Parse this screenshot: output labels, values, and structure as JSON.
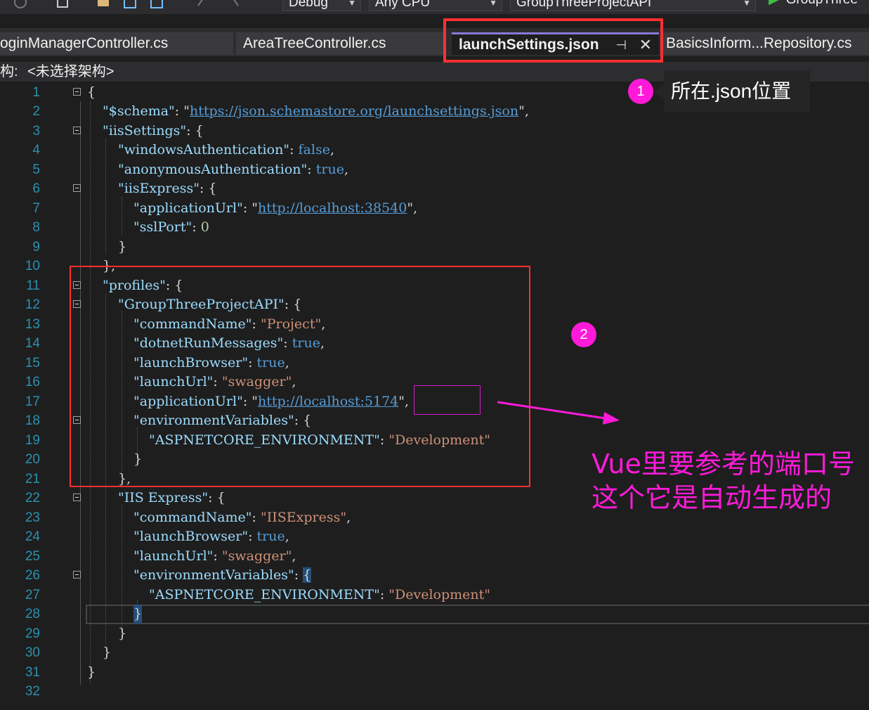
{
  "toolbar": {
    "config": "Debug",
    "platform": "Any CPU",
    "startup_project": "GroupThreeProjectAPI",
    "run_label": "GroupThree"
  },
  "tabs": [
    {
      "label": "oginManagerController.cs"
    },
    {
      "label": "AreaTreeController.cs"
    },
    {
      "label": "launchSettings.json",
      "active": true
    },
    {
      "label": "BasicsInform...Repository.cs"
    }
  ],
  "navbar": {
    "prefix": "构:",
    "value": "<未选择架构>"
  },
  "line_numbers": [
    "1",
    "2",
    "3",
    "4",
    "5",
    "6",
    "7",
    "8",
    "9",
    "10",
    "11",
    "12",
    "13",
    "14",
    "15",
    "16",
    "17",
    "18",
    "19",
    "20",
    "21",
    "22",
    "23",
    "24",
    "25",
    "26",
    "27",
    "28",
    "29",
    "30",
    "31",
    "32"
  ],
  "code": {
    "l1": "{",
    "l2_key": "\"$schema\"",
    "l2_val": "https://json.schemastore.org/launchsettings.json",
    "l3_key": "\"iisSettings\"",
    "l4_key": "\"windowsAuthentication\"",
    "l4_val": "false",
    "l5_key": "\"anonymousAuthentication\"",
    "l5_val": "true",
    "l6_key": "\"iisExpress\"",
    "l7_key": "\"applicationUrl\"",
    "l7_val": "http://localhost:38540",
    "l8_key": "\"sslPort\"",
    "l8_val": "0",
    "l9": "}",
    "l10": "},",
    "l11_key": "\"profiles\"",
    "l12_key": "\"GroupThreeProjectAPI\"",
    "l13_key": "\"commandName\"",
    "l13_val": "\"Project\"",
    "l14_key": "\"dotnetRunMessages\"",
    "l14_val": "true",
    "l15_key": "\"launchBrowser\"",
    "l15_val": "true",
    "l16_key": "\"launchUrl\"",
    "l16_val": "\"swagger\"",
    "l17_key": "\"applicationUrl\"",
    "l17_val_a": "http://localhost:",
    "l17_val_b": "5174",
    "l18_key": "\"environmentVariables\"",
    "l19_key": "\"ASPNETCORE_ENVIRONMENT\"",
    "l19_val": "\"Development\"",
    "l20": "}",
    "l21": "},",
    "l22_key": "\"IIS Express\"",
    "l23_key": "\"commandName\"",
    "l23_val": "\"IISExpress\"",
    "l24_key": "\"launchBrowser\"",
    "l24_val": "true",
    "l25_key": "\"launchUrl\"",
    "l25_val": "\"swagger\"",
    "l26_key": "\"environmentVariables\"",
    "l27_key": "\"ASPNETCORE_ENVIRONMENT\"",
    "l27_val": "\"Development\"",
    "l28": "}",
    "l29": "}",
    "l30": "}",
    "l31": "}"
  },
  "annotations": {
    "badge1": "1",
    "tip1": "所在.json位置",
    "badge2": "2",
    "note_line1": "Vue里要参考的端口号",
    "note_line2": "这个它是自动生成的"
  },
  "colors": {
    "highlight_red": "#ff3030",
    "annotation_magenta": "#ff1ad9",
    "tab_accent": "#8a78d8"
  }
}
